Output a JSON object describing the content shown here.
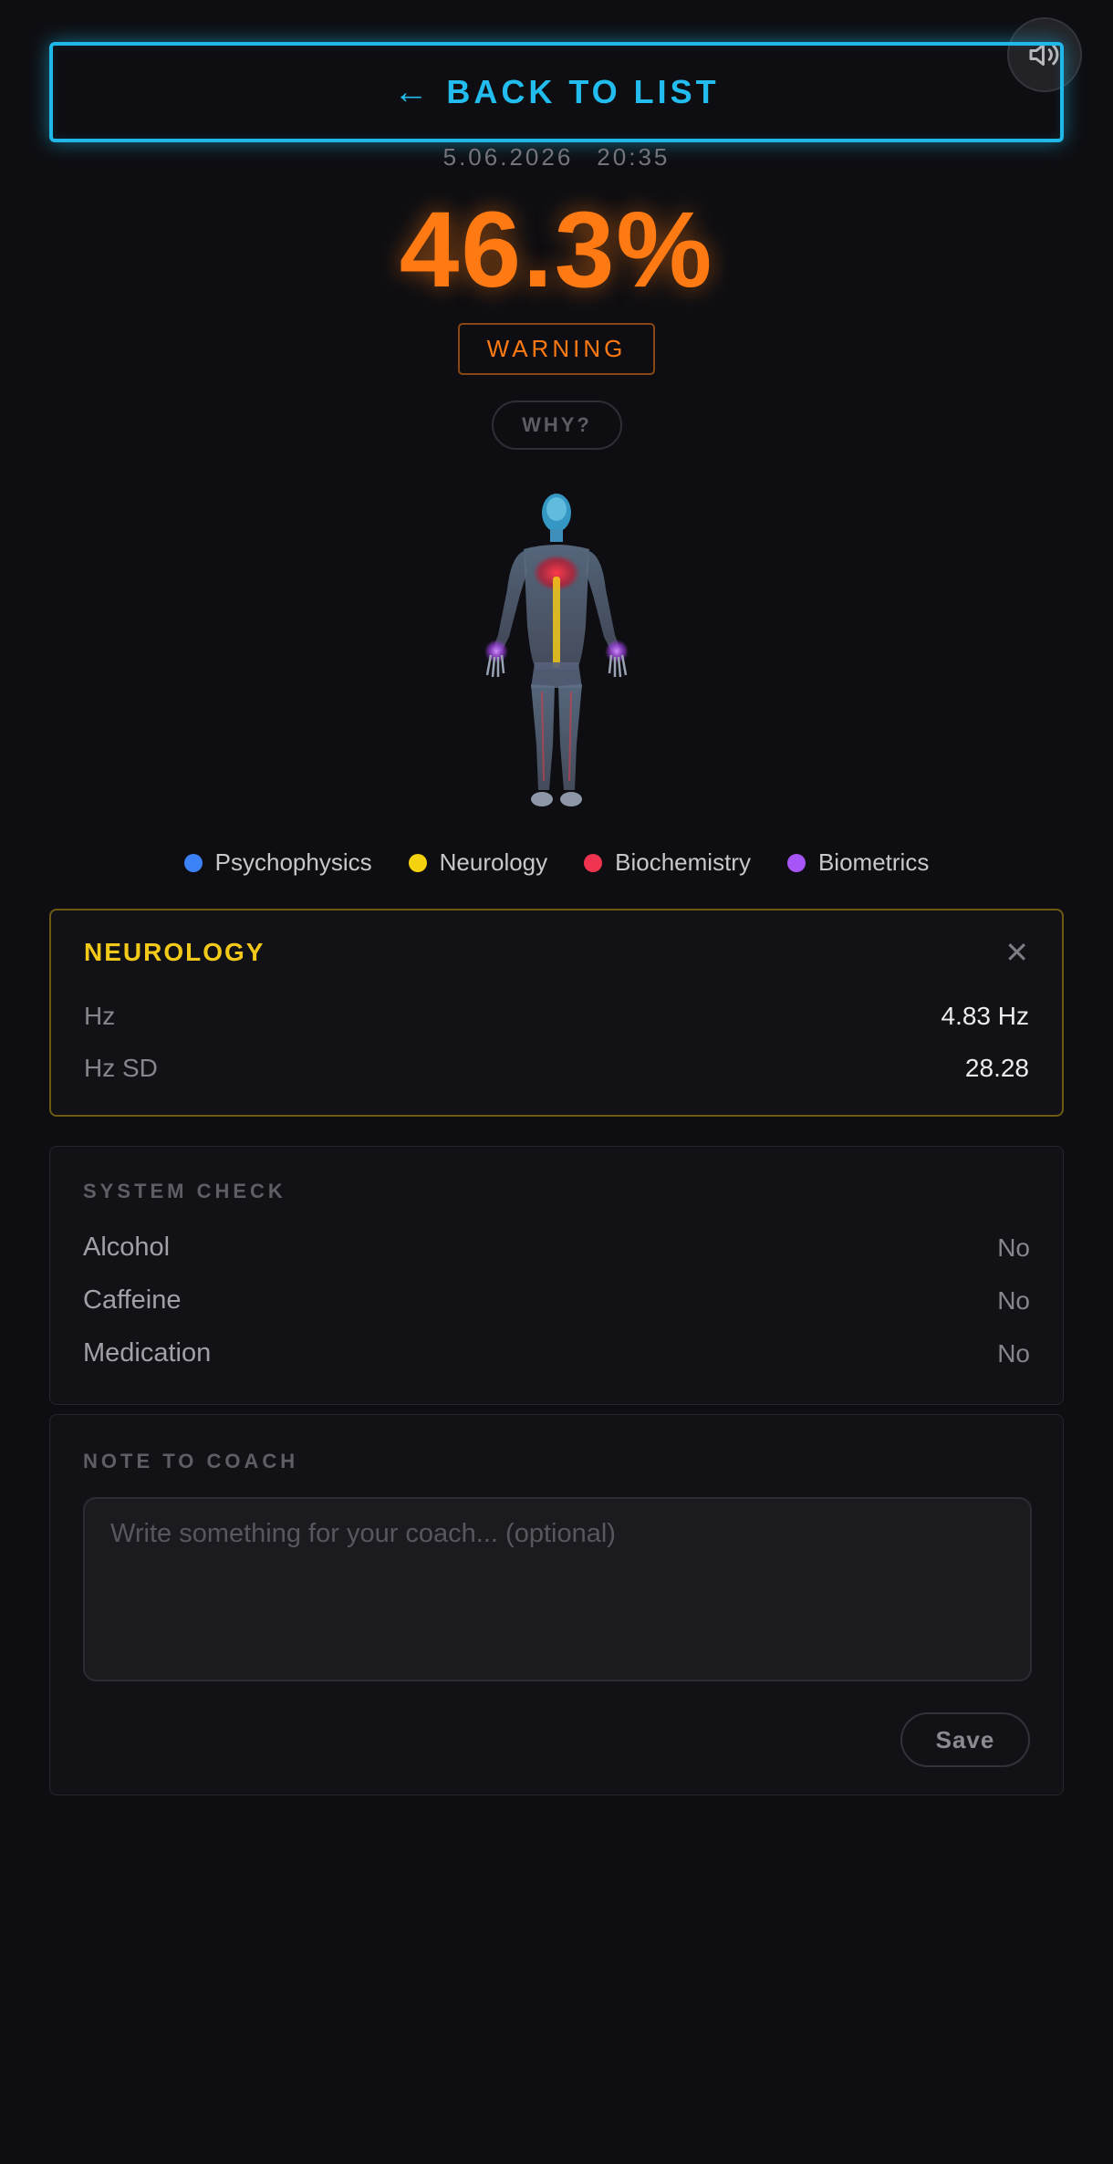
{
  "header": {
    "back_label": "BACK TO LIST",
    "back_arrow": "←",
    "date": "5.06.2026",
    "time": "20:35"
  },
  "result": {
    "score": "46.3%",
    "status": "WARNING",
    "why_label": "WHY?"
  },
  "legend": [
    {
      "label": "Psychophysics",
      "color": "#3b82f6"
    },
    {
      "label": "Neurology",
      "color": "#f5d20f"
    },
    {
      "label": "Biochemistry",
      "color": "#f0344f"
    },
    {
      "label": "Biometrics",
      "color": "#a855f7"
    }
  ],
  "detail": {
    "title": "NEUROLOGY",
    "close": "✕",
    "rows": [
      {
        "label": "Hz",
        "value": "4.83 Hz"
      },
      {
        "label": "Hz SD",
        "value": "28.28"
      }
    ]
  },
  "system_check": {
    "title": "SYSTEM CHECK",
    "rows": [
      {
        "label": "Alcohol",
        "value": "No"
      },
      {
        "label": "Caffeine",
        "value": "No"
      },
      {
        "label": "Medication",
        "value": "No"
      }
    ]
  },
  "note": {
    "title": "NOTE TO COACH",
    "placeholder": "Write something for your coach... (optional)",
    "value": "",
    "save_label": "Save"
  },
  "colors": {
    "accent": "#22bdee",
    "warning": "#ff7a12",
    "neurology": "#f2c919"
  }
}
